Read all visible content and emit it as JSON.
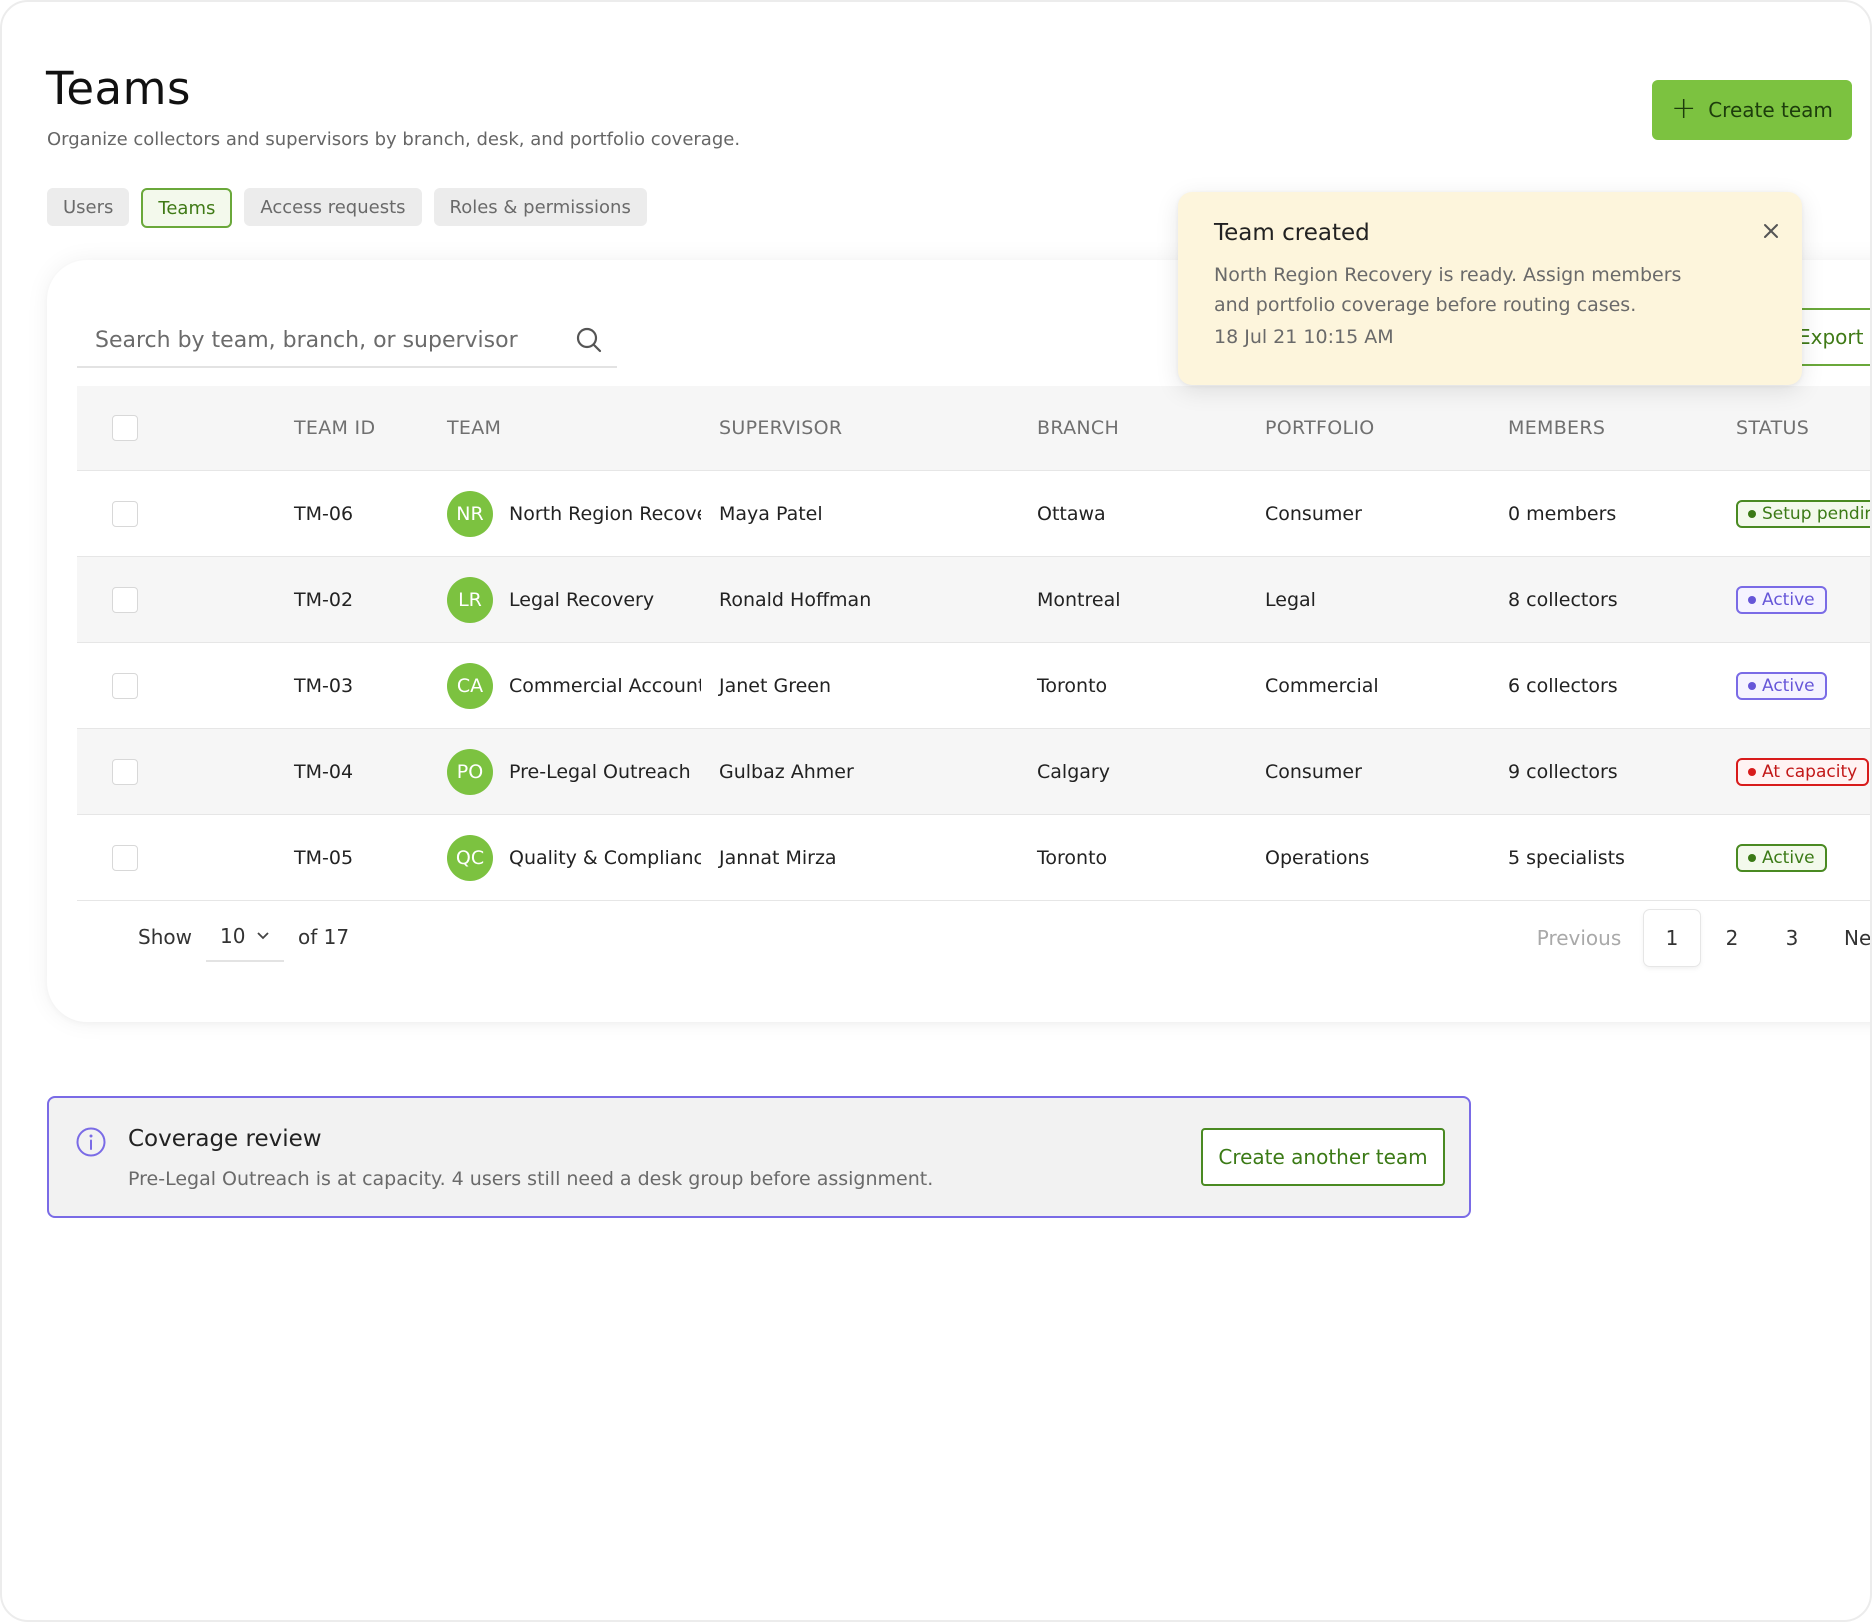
{
  "header": {
    "title": "Teams",
    "subtitle": "Organize collectors and supervisors by branch, desk, and portfolio coverage.",
    "create_label": "Create team"
  },
  "tabs": [
    {
      "label": "Users"
    },
    {
      "label": "Teams",
      "active": true
    },
    {
      "label": "Access requests"
    },
    {
      "label": "Roles & permissions"
    }
  ],
  "search": {
    "placeholder": "Search by team, branch, or supervisor",
    "value": ""
  },
  "export_label": "Export teams",
  "table": {
    "columns": [
      "TEAM ID",
      "TEAM",
      "SUPERVISOR",
      "BRANCH",
      "PORTFOLIO",
      "MEMBERS",
      "STATUS"
    ],
    "rows": [
      {
        "id": "TM-06",
        "initials": "NR",
        "team": "North Region Recovery",
        "supervisor": "Maya Patel",
        "branch": "Ottawa",
        "portfolio": "Consumer",
        "members": "0 members",
        "status": "Setup pending",
        "status_tone": "green"
      },
      {
        "id": "TM-02",
        "initials": "LR",
        "team": "Legal Recovery",
        "supervisor": "Ronald Hoffman",
        "branch": "Montreal",
        "portfolio": "Legal",
        "members": "8 collectors",
        "status": "Active",
        "status_tone": "purple"
      },
      {
        "id": "TM-03",
        "initials": "CA",
        "team": "Commercial Accounts",
        "supervisor": "Janet Green",
        "branch": "Toronto",
        "portfolio": "Commercial",
        "members": "6 collectors",
        "status": "Active",
        "status_tone": "purple"
      },
      {
        "id": "TM-04",
        "initials": "PO",
        "team": "Pre-Legal Outreach",
        "supervisor": "Gulbaz Ahmer",
        "branch": "Calgary",
        "portfolio": "Consumer",
        "members": "9 collectors",
        "status": "At capacity",
        "status_tone": "red"
      },
      {
        "id": "TM-05",
        "initials": "QC",
        "team": "Quality & Compliance",
        "supervisor": "Jannat Mirza",
        "branch": "Toronto",
        "portfolio": "Operations",
        "members": "5 specialists",
        "status": "Active",
        "status_tone": "green"
      }
    ]
  },
  "pagination": {
    "show_label": "Show",
    "page_size": "10",
    "total_label": "of 17",
    "previous_label": "Previous",
    "pages": [
      "1",
      "2",
      "3"
    ],
    "current_page": "1",
    "next_label": "Next"
  },
  "toast": {
    "title": "Team created",
    "body": "North Region Recovery is ready. Assign members and portfolio coverage before routing cases.",
    "time": "18 Jul 21 10:15 AM"
  },
  "banner": {
    "title": "Coverage review",
    "text": "Pre-Legal Outreach is at capacity. 4 users still need a desk group before assignment.",
    "button_label": "Create another team"
  },
  "colors": {
    "accent_green": "#7cc240",
    "active_purple": "#6656d8",
    "danger_red": "#d81b1b",
    "toast_bg": "#fdf5dc"
  }
}
